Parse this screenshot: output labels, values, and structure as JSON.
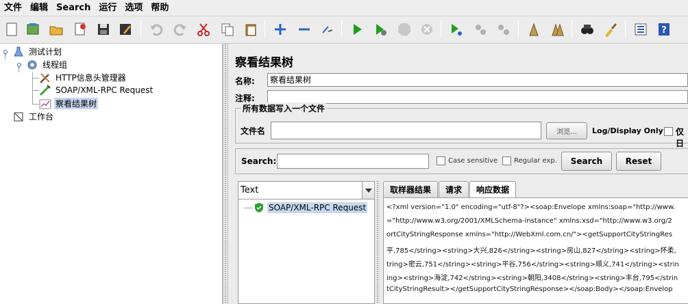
{
  "menu": [
    "文件",
    "编辑",
    "Search",
    "运行",
    "选项",
    "帮助"
  ],
  "toolbar": {
    "icons": [
      "new-icon",
      "templates-icon",
      "open-icon",
      "close-icon",
      "save-icon",
      "save-as-icon",
      "undo-icon",
      "redo-icon",
      "cut-icon",
      "copy-icon",
      "paste-icon",
      "expand-icon",
      "collapse-icon",
      "toggle-icon",
      "start-icon",
      "start-no-pause-icon",
      "stop-icon",
      "shutdown-icon",
      "remote-start-icon",
      "remote-stop-icon",
      "remote-shutdown-icon",
      "clear-icon",
      "clear-all-icon",
      "search-icon",
      "reset-search-icon",
      "function-helper-icon",
      "help-icon"
    ]
  },
  "tree": {
    "test_plan": "测试计划",
    "thread_group": "线程组",
    "http_header_manager": "HTTP信息头管理器",
    "soap_request": "SOAP/XML-RPC Request",
    "view_results_tree": "察看结果树",
    "workbench": "工作台"
  },
  "panel": {
    "title": "察看结果树",
    "name_label": "名称:",
    "name_value": "察看结果树",
    "comment_label": "注释:",
    "comment_value": "",
    "file_group_title": "所有数据写入一个文件",
    "filename_label": "文件名",
    "filename_value": "",
    "browse_label": "浏览...",
    "log_display_label": "Log/Display Only:",
    "errors_only_label": "仅日",
    "search_label": "Search:",
    "search_value": "",
    "case_sensitive_label": "Case sensitive",
    "regex_label": "Regular exp.",
    "search_button": "Search",
    "reset_button": "Reset"
  },
  "results": {
    "renderer": "Text",
    "sample_label": "SOAP/XML-RPC Request",
    "tabs": [
      "取样器结果",
      "请求",
      "响应数据"
    ],
    "active_tab": "响应数据",
    "response_lines": [
      "<?xml version=\"1.0\" encoding=\"utf-8\"?><soap:Envelope xmlns:soap=\"http://www.",
      "=\"http://www.w3.org/2001/XMLSchema-instance\" xmlns:xsd=\"http://www.w3.org/2",
      "ortCityStringResponse xmlns=\"http://WebXml.com.cn/\"><getSupportCityStringRes",
      "平,785</string><string>大兴,826</string><string>房山,827</string><string>怀柔,",
      "tring>密云,751</string><string>平谷,756</string><string>顺义,741</string><strin",
      "ing><string>海淀,742</string><string>朝阳,3408</string><string>丰台,795</strin",
      "tCityStringResult></getSupportCityStringResponse></soap:Body></soap:Envelop"
    ]
  },
  "colors": {
    "selection": "#c6d8f0",
    "play_green": "#1ea11e",
    "help_blue": "#2a56b8"
  }
}
